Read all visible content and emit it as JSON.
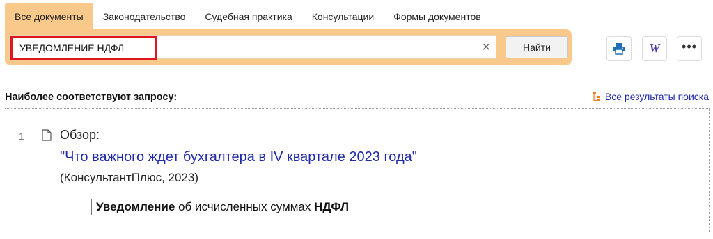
{
  "tabs": [
    {
      "label": "Все документы",
      "active": true
    },
    {
      "label": "Законодательство",
      "active": false
    },
    {
      "label": "Судебная практика",
      "active": false
    },
    {
      "label": "Консультации",
      "active": false
    },
    {
      "label": "Формы документов",
      "active": false
    }
  ],
  "search": {
    "query": "УВЕДОМЛЕНИЕ НДФЛ",
    "clear_symbol": "×",
    "find_label": "Найти"
  },
  "toolbar": {
    "print_icon": "printer-icon",
    "word_label": "W",
    "more_label": "•••"
  },
  "results": {
    "title": "Наиболее соответствуют запросу:",
    "all_results_label": "Все результаты поиска",
    "items": [
      {
        "number": "1",
        "type": "Обзор:",
        "title": "\"Что важного ждет бухгалтера в IV квартале 2023 года\"",
        "source": "(КонсультантПлюс, 2023)",
        "snippet": {
          "term1": "Уведомление",
          "middle": " об исчисленных суммах ",
          "term2": "НДФЛ"
        }
      }
    ]
  },
  "colors": {
    "accent": "#f8c98a",
    "link": "#1f2aa8",
    "highlight_border": "#e0161e",
    "icon_orange": "#f07d1c"
  }
}
